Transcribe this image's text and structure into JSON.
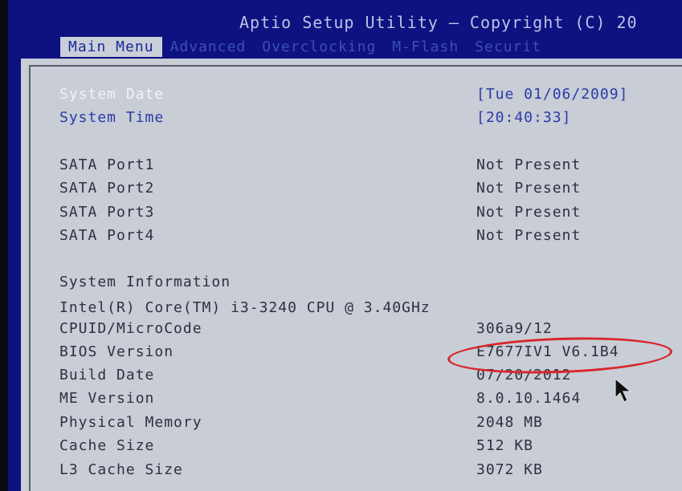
{
  "header": {
    "title": "Aptio Setup Utility – Copyright (C) 20",
    "tabs": [
      "Main Menu",
      "Advanced",
      "Overclocking",
      "M-Flash",
      "Securit"
    ]
  },
  "main": {
    "system_date": {
      "label": "System Date",
      "value": "[Tue 01/06/2009]"
    },
    "system_time": {
      "label": "System Time",
      "value": "[20:40:33]"
    },
    "sata": [
      {
        "label": "SATA Port1",
        "value": "Not Present"
      },
      {
        "label": "SATA Port2",
        "value": "Not Present"
      },
      {
        "label": "SATA Port3",
        "value": "Not Present"
      },
      {
        "label": "SATA Port4",
        "value": "Not Present"
      }
    ],
    "system_information_label": "System Information",
    "cpu": "Intel(R) Core(TM) i3-3240 CPU @ 3.40GHz",
    "info": [
      {
        "label": "CPUID/MicroCode",
        "value": "306a9/12"
      },
      {
        "label": "BIOS Version",
        "value": "E7677IV1 V6.1B4"
      },
      {
        "label": "Build Date",
        "value": "07/20/2012"
      },
      {
        "label": "ME Version",
        "value": "8.0.10.1464"
      },
      {
        "label": "Physical Memory",
        "value": "2048 MB"
      },
      {
        "label": "Cache Size",
        "value": "512 KB"
      },
      {
        "label": "L3 Cache Size",
        "value": "3072 KB"
      }
    ]
  },
  "colors": {
    "bios_blue": "#0e1180",
    "panel_gray": "#c8cdd6",
    "highlight_ring": "#d8262a"
  }
}
